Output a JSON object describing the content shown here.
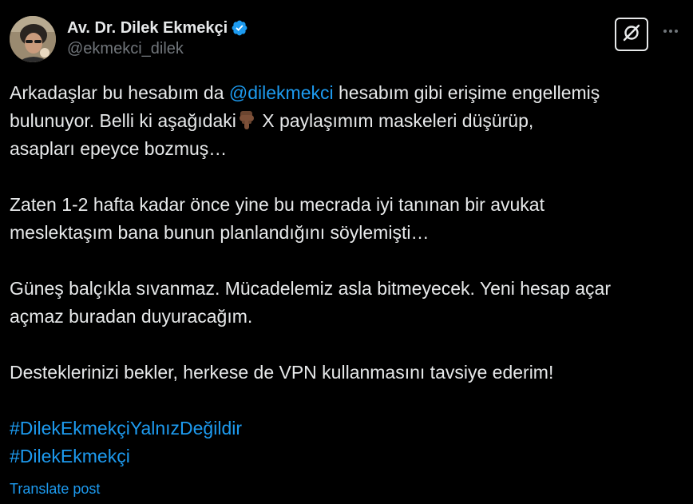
{
  "author": {
    "display_name": "Av. Dr. Dilek Ekmekçi",
    "handle": "@ekmekci_dilek",
    "verified": true
  },
  "icons": {
    "verified": "verified-badge-icon",
    "grok": "grok-icon",
    "more": "more-icon"
  },
  "tweet": {
    "p1_a": "Arkadaşlar bu hesabım da ",
    "p1_mention": "@dilekmekci",
    "p1_b": " hesabım gibi erişime engellemiş",
    "p1_c": "bulunuyor.  Belli ki aşağıdaki",
    "p1_d": " X paylaşımım maskeleri düşürüp,",
    "p1_e": "asapları epeyce bozmuş…",
    "p2_a": "Zaten 1-2 hafta kadar önce yine bu mecrada iyi tanınan bir avukat",
    "p2_b": "meslektaşım bana bunun planlandığını söylemişti…",
    "p3_a": "Güneş balçıkla sıvanmaz. Mücadelemiz asla bitmeyecek. Yeni hesap açar",
    "p3_b": "açmaz buradan duyuracağım.",
    "p4": "Desteklerinizi bekler, herkese de VPN kullanmasını tavsiye ederim!",
    "hashtag_1": "#DilekEkmekçiYalnızDeğildir",
    "hashtag_2": "#DilekEkmekçi"
  },
  "translate_label": "Translate post",
  "colors": {
    "background": "#000000",
    "text": "#e7e9ea",
    "secondary": "#71767b",
    "link": "#1d9bf0"
  }
}
